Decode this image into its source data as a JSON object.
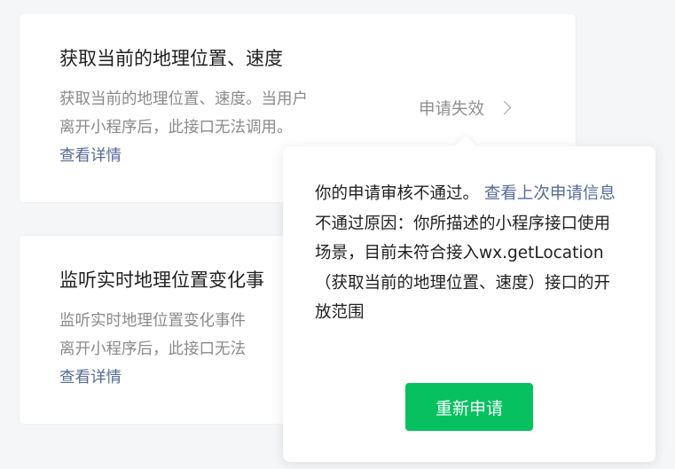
{
  "cards": [
    {
      "title": "获取当前的地理位置、速度",
      "desc_line1": "获取当前的地理位置、速度。当用户",
      "desc_line2": "离开小程序后，此接口无法调用。",
      "link": "查看详情",
      "status": "申请失效"
    },
    {
      "title": "监听实时地理位置变化事",
      "desc_line1": "监听实时地理位置变化事件",
      "desc_line2": "离开小程序后，此接口无法",
      "link": "查看详情"
    }
  ],
  "popover": {
    "intro": "你的申请审核不通过。",
    "link": "查看上次申请信息",
    "reason": "不通过原因：你所描述的小程序接口使用场景，目前未符合接入wx.getLocation（获取当前的地理位置、速度）接口的开放范围",
    "button": "重新申请"
  },
  "colors": {
    "link": "#576b95",
    "primary": "#07c160",
    "background": "#f5f6f8"
  },
  "icons": {
    "status_chevron": "chevron-right-icon"
  }
}
